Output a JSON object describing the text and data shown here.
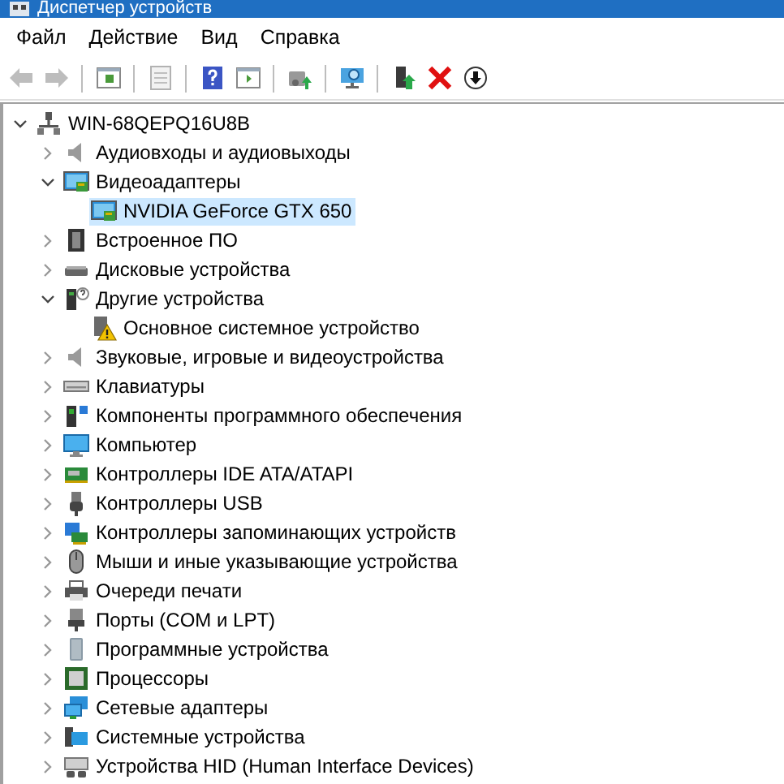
{
  "window": {
    "title": "Диспетчер устройств"
  },
  "menu": [
    {
      "label": "Файл"
    },
    {
      "label": "Действие"
    },
    {
      "label": "Вид"
    },
    {
      "label": "Справка"
    }
  ],
  "toolbar": [
    {
      "kind": "back",
      "disabled": true
    },
    {
      "kind": "forward",
      "disabled": true
    },
    {
      "kind": "separator"
    },
    {
      "kind": "tree",
      "disabled": false
    },
    {
      "kind": "separator"
    },
    {
      "kind": "properties",
      "disabled": true
    },
    {
      "kind": "separator"
    },
    {
      "kind": "help",
      "disabled": false
    },
    {
      "kind": "pane",
      "disabled": false
    },
    {
      "kind": "separator"
    },
    {
      "kind": "update",
      "disabled": false
    },
    {
      "kind": "separator"
    },
    {
      "kind": "scan",
      "disabled": false
    },
    {
      "kind": "separator"
    },
    {
      "kind": "enable",
      "disabled": false
    },
    {
      "kind": "uninstall",
      "disabled": false
    },
    {
      "kind": "disable",
      "disabled": false
    }
  ],
  "tree": {
    "label": "WIN-68QEPQ16U8B",
    "expanded": true,
    "selected": false,
    "children": [
      {
        "label": "Аудиовходы и аудиовыходы",
        "expanded": false,
        "selected": false
      },
      {
        "label": "Видеоадаптеры",
        "expanded": true,
        "selected": false,
        "children": [
          {
            "label": "NVIDIA GeForce GTX 650",
            "selected": true
          }
        ]
      },
      {
        "label": "Встроенное ПО",
        "expanded": false,
        "selected": false
      },
      {
        "label": "Дисковые устройства",
        "expanded": false,
        "selected": false
      },
      {
        "label": "Другие устройства",
        "expanded": true,
        "selected": false,
        "children": [
          {
            "label": "Основное системное устройство",
            "selected": false
          }
        ]
      },
      {
        "label": "Звуковые, игровые и видеоустройства",
        "expanded": false,
        "selected": false
      },
      {
        "label": "Клавиатуры",
        "expanded": false,
        "selected": false
      },
      {
        "label": "Компоненты программного обеспечения",
        "expanded": false,
        "selected": false
      },
      {
        "label": "Компьютер",
        "expanded": false,
        "selected": false
      },
      {
        "label": "Контроллеры IDE ATA/ATAPI",
        "expanded": false,
        "selected": false
      },
      {
        "label": "Контроллеры USB",
        "expanded": false,
        "selected": false
      },
      {
        "label": "Контроллеры запоминающих устройств",
        "expanded": false,
        "selected": false
      },
      {
        "label": "Мыши и иные указывающие устройства",
        "expanded": false,
        "selected": false
      },
      {
        "label": "Очереди печати",
        "expanded": false,
        "selected": false
      },
      {
        "label": "Порты (COM и LPT)",
        "expanded": false,
        "selected": false
      },
      {
        "label": "Программные устройства",
        "expanded": false,
        "selected": false
      },
      {
        "label": "Процессоры",
        "expanded": false,
        "selected": false
      },
      {
        "label": "Сетевые адаптеры",
        "expanded": false,
        "selected": false
      },
      {
        "label": "Системные устройства",
        "expanded": false,
        "selected": false
      },
      {
        "label": "Устройства HID (Human Interface Devices)",
        "expanded": false,
        "selected": false
      }
    ]
  }
}
